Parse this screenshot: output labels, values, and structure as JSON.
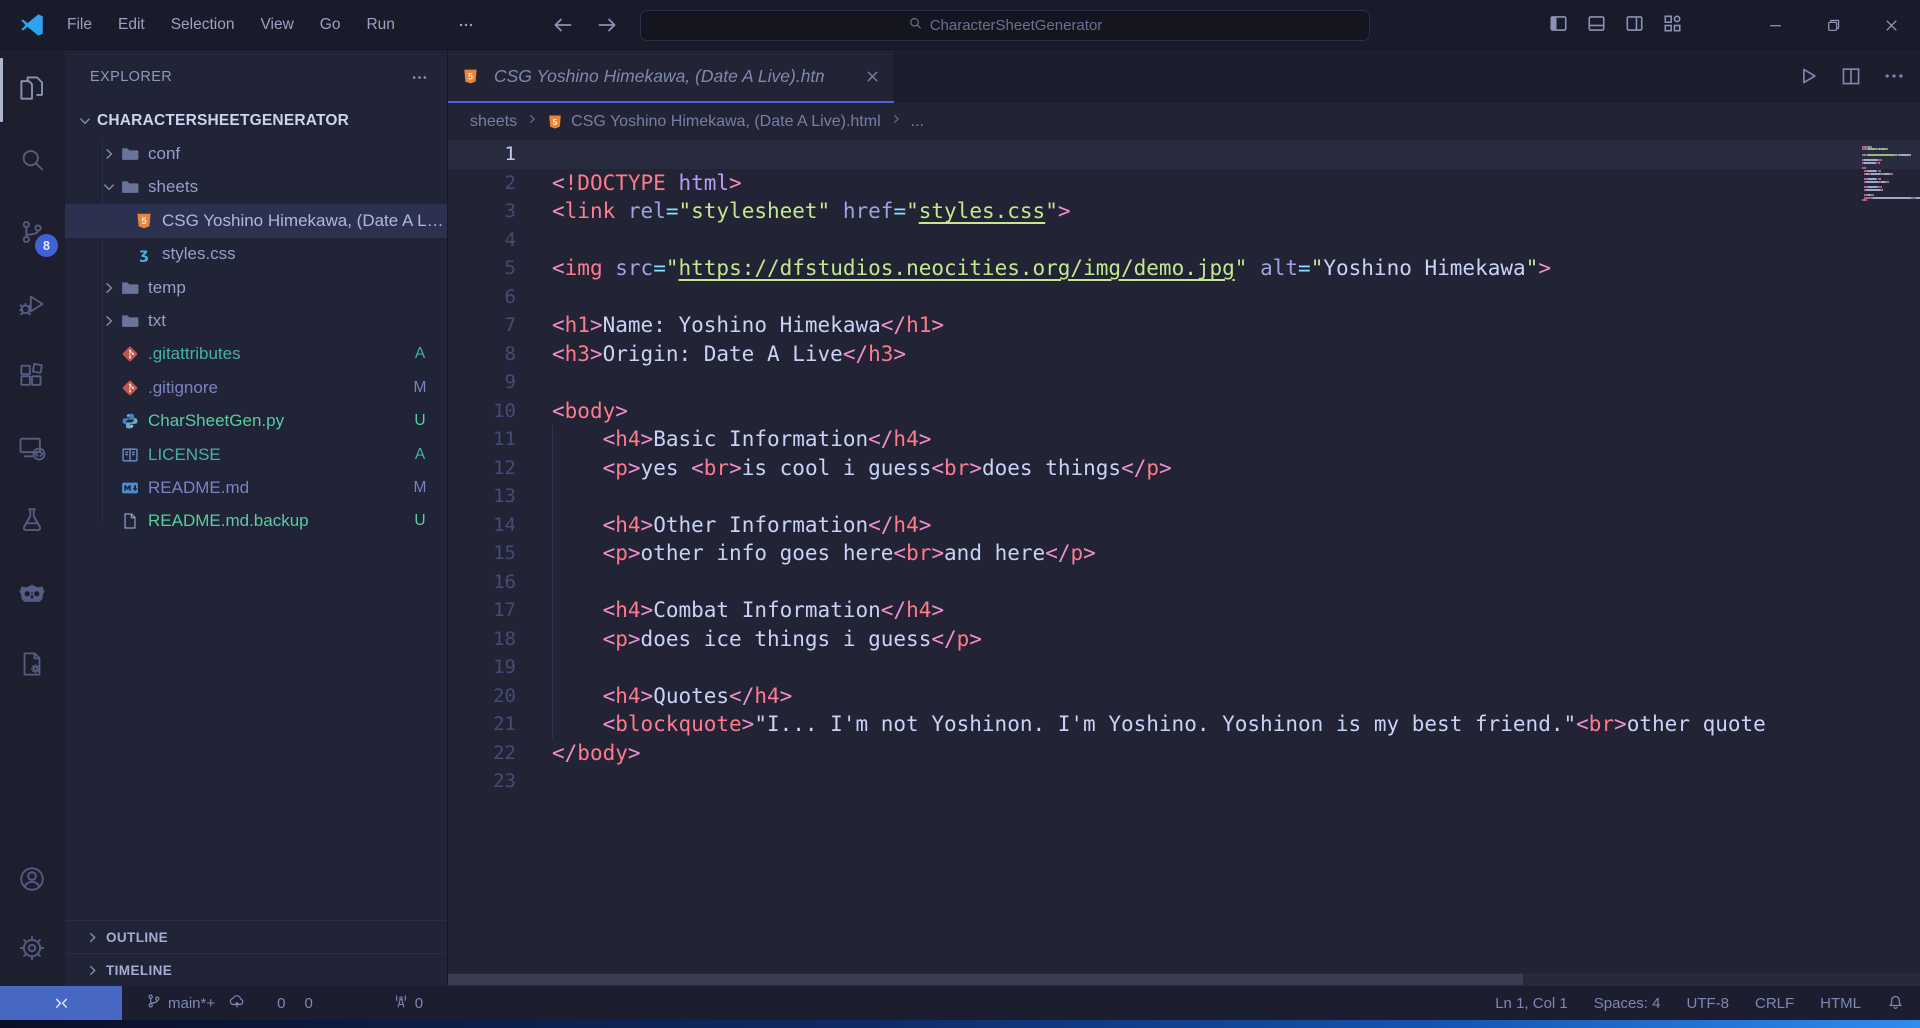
{
  "colors": {
    "accent_tab_border": "#4468e0",
    "remote_statusbar_blue": "#4668c2",
    "scm_badge_blue": "#3f63d6",
    "editor_bg": "#222436",
    "git": {
      "A": "#45b3a2",
      "M": "#7a83c5",
      "U": "#55cfa0"
    },
    "syntax": {
      "pb": "#f18fcb",
      "tag": "#ff7a8c",
      "kw": "#bb9cf5",
      "at": "#9ba4e2",
      "eq": "#86e1fc",
      "st": "#c3e88d",
      "lk": "#c3e88d",
      "tx": "#c8d3f5",
      "ws": "transparent"
    }
  },
  "title_bar": {
    "menus": [
      "File",
      "Edit",
      "Selection",
      "View",
      "Go",
      "Run"
    ],
    "search_text": "CharacterSheetGenerator"
  },
  "activity_bar": {
    "source_control_badge": "8"
  },
  "sidebar": {
    "header": "EXPLORER",
    "root": "CHARACTERSHEETGENERATOR",
    "items": [
      {
        "label": "conf",
        "icon": "folder",
        "chev": "r",
        "level": 1
      },
      {
        "label": "sheets",
        "icon": "folder",
        "chev": "d",
        "level": 1
      },
      {
        "label": "CSG Yoshino Himekawa, (Date A Live).html",
        "icon": "html",
        "level": 2,
        "sel": true
      },
      {
        "label": "styles.css",
        "icon": "css",
        "level": 2
      },
      {
        "label": "temp",
        "icon": "folder",
        "chev": "r",
        "level": 1
      },
      {
        "label": "txt",
        "icon": "folder",
        "chev": "r",
        "level": 1
      },
      {
        "label": ".gitattributes",
        "icon": "git",
        "level": 1,
        "status": "A"
      },
      {
        "label": ".gitignore",
        "icon": "git",
        "level": 1,
        "status": "M"
      },
      {
        "label": "CharSheetGen.py",
        "icon": "python",
        "level": 1,
        "status": "U"
      },
      {
        "label": "LICENSE",
        "icon": "license",
        "level": 1,
        "status": "A"
      },
      {
        "label": "README.md",
        "icon": "markdown",
        "level": 1,
        "status": "M"
      },
      {
        "label": "README.md.backup",
        "icon": "file",
        "level": 1,
        "status": "U"
      }
    ],
    "sections": [
      "OUTLINE",
      "TIMELINE"
    ]
  },
  "editor": {
    "tab": {
      "label": "CSG Yoshino Himekawa, (Date A Live).html",
      "icon": "html"
    },
    "breadcrumbs": {
      "folder": "sheets",
      "file": "CSG Yoshino Himekawa, (Date A Live).html",
      "more": "..."
    },
    "active_line": 1,
    "lines": [
      {
        "n": 1,
        "hl": 1,
        "t": []
      },
      {
        "n": 2,
        "t": [
          [
            "pb",
            "<"
          ],
          [
            "tag",
            "!DOCTYPE"
          ],
          [
            "tx",
            " "
          ],
          [
            "kw",
            "html"
          ],
          [
            "pb",
            ">"
          ]
        ]
      },
      {
        "n": 3,
        "t": [
          [
            "pb",
            "<"
          ],
          [
            "tag",
            "link"
          ],
          [
            "tx",
            " "
          ],
          [
            "at",
            "rel"
          ],
          [
            "eq",
            "="
          ],
          [
            "st",
            "\"stylesheet\""
          ],
          [
            "tx",
            " "
          ],
          [
            "at",
            "href"
          ],
          [
            "eq",
            "="
          ],
          [
            "st",
            "\""
          ],
          [
            "lk",
            "styles.css"
          ],
          [
            "st",
            "\""
          ],
          [
            "pb",
            ">"
          ]
        ]
      },
      {
        "n": 4,
        "t": []
      },
      {
        "n": 5,
        "t": [
          [
            "pb",
            "<"
          ],
          [
            "tag",
            "img"
          ],
          [
            "tx",
            " "
          ],
          [
            "at",
            "src"
          ],
          [
            "eq",
            "="
          ],
          [
            "st",
            "\""
          ],
          [
            "lk",
            "https://dfstudios.neocities.org/img/demo.jpg"
          ],
          [
            "st",
            "\""
          ],
          [
            "tx",
            " "
          ],
          [
            "at",
            "alt"
          ],
          [
            "eq",
            "="
          ],
          [
            "st",
            "\""
          ],
          [
            "tx",
            "Yoshino Himekawa"
          ],
          [
            "st",
            "\""
          ],
          [
            "pb",
            ">"
          ]
        ]
      },
      {
        "n": 6,
        "t": []
      },
      {
        "n": 7,
        "t": [
          [
            "pb",
            "<"
          ],
          [
            "tag",
            "h1"
          ],
          [
            "pb",
            ">"
          ],
          [
            "tx",
            "Name: Yoshino Himekawa"
          ],
          [
            "pb",
            "</"
          ],
          [
            "tag",
            "h1"
          ],
          [
            "pb",
            ">"
          ]
        ]
      },
      {
        "n": 8,
        "t": [
          [
            "pb",
            "<"
          ],
          [
            "tag",
            "h3"
          ],
          [
            "pb",
            ">"
          ],
          [
            "tx",
            "Origin: Date A Live"
          ],
          [
            "pb",
            "</"
          ],
          [
            "tag",
            "h3"
          ],
          [
            "pb",
            ">"
          ]
        ]
      },
      {
        "n": 9,
        "t": []
      },
      {
        "n": 10,
        "t": [
          [
            "pb",
            "<"
          ],
          [
            "tag",
            "body"
          ],
          [
            "pb",
            ">"
          ]
        ]
      },
      {
        "n": 11,
        "g": 1,
        "t": [
          [
            "ws",
            "    "
          ],
          [
            "pb",
            "<"
          ],
          [
            "tag",
            "h4"
          ],
          [
            "pb",
            ">"
          ],
          [
            "tx",
            "Basic Information"
          ],
          [
            "pb",
            "</"
          ],
          [
            "tag",
            "h4"
          ],
          [
            "pb",
            ">"
          ]
        ]
      },
      {
        "n": 12,
        "g": 1,
        "t": [
          [
            "ws",
            "    "
          ],
          [
            "pb",
            "<"
          ],
          [
            "tag",
            "p"
          ],
          [
            "pb",
            ">"
          ],
          [
            "tx",
            "yes "
          ],
          [
            "pb",
            "<"
          ],
          [
            "tag",
            "br"
          ],
          [
            "pb",
            ">"
          ],
          [
            "tx",
            "is cool i guess"
          ],
          [
            "pb",
            "<"
          ],
          [
            "tag",
            "br"
          ],
          [
            "pb",
            ">"
          ],
          [
            "tx",
            "does things"
          ],
          [
            "pb",
            "</"
          ],
          [
            "tag",
            "p"
          ],
          [
            "pb",
            ">"
          ]
        ]
      },
      {
        "n": 13,
        "g": 1,
        "t": []
      },
      {
        "n": 14,
        "g": 1,
        "t": [
          [
            "ws",
            "    "
          ],
          [
            "pb",
            "<"
          ],
          [
            "tag",
            "h4"
          ],
          [
            "pb",
            ">"
          ],
          [
            "tx",
            "Other Information"
          ],
          [
            "pb",
            "</"
          ],
          [
            "tag",
            "h4"
          ],
          [
            "pb",
            ">"
          ]
        ]
      },
      {
        "n": 15,
        "g": 1,
        "t": [
          [
            "ws",
            "    "
          ],
          [
            "pb",
            "<"
          ],
          [
            "tag",
            "p"
          ],
          [
            "pb",
            ">"
          ],
          [
            "tx",
            "other info goes here"
          ],
          [
            "pb",
            "<"
          ],
          [
            "tag",
            "br"
          ],
          [
            "pb",
            ">"
          ],
          [
            "tx",
            "and here"
          ],
          [
            "pb",
            "</"
          ],
          [
            "tag",
            "p"
          ],
          [
            "pb",
            ">"
          ]
        ]
      },
      {
        "n": 16,
        "g": 1,
        "t": []
      },
      {
        "n": 17,
        "g": 1,
        "t": [
          [
            "ws",
            "    "
          ],
          [
            "pb",
            "<"
          ],
          [
            "tag",
            "h4"
          ],
          [
            "pb",
            ">"
          ],
          [
            "tx",
            "Combat Information"
          ],
          [
            "pb",
            "</"
          ],
          [
            "tag",
            "h4"
          ],
          [
            "pb",
            ">"
          ]
        ]
      },
      {
        "n": 18,
        "g": 1,
        "t": [
          [
            "ws",
            "    "
          ],
          [
            "pb",
            "<"
          ],
          [
            "tag",
            "p"
          ],
          [
            "pb",
            ">"
          ],
          [
            "tx",
            "does ice things i guess"
          ],
          [
            "pb",
            "</"
          ],
          [
            "tag",
            "p"
          ],
          [
            "pb",
            ">"
          ]
        ]
      },
      {
        "n": 19,
        "g": 1,
        "t": []
      },
      {
        "n": 20,
        "g": 1,
        "t": [
          [
            "ws",
            "    "
          ],
          [
            "pb",
            "<"
          ],
          [
            "tag",
            "h4"
          ],
          [
            "pb",
            ">"
          ],
          [
            "tx",
            "Quotes"
          ],
          [
            "pb",
            "</"
          ],
          [
            "tag",
            "h4"
          ],
          [
            "pb",
            ">"
          ]
        ]
      },
      {
        "n": 21,
        "g": 1,
        "t": [
          [
            "ws",
            "    "
          ],
          [
            "pb",
            "<"
          ],
          [
            "tag",
            "blockquote"
          ],
          [
            "pb",
            ">"
          ],
          [
            "tx",
            "\"I... I'm not Yoshinon. I'm Yoshino. Yoshinon is my best friend.\""
          ],
          [
            "pb",
            "<"
          ],
          [
            "tag",
            "br"
          ],
          [
            "pb",
            ">"
          ],
          [
            "tx",
            "other quote"
          ]
        ]
      },
      {
        "n": 22,
        "t": [
          [
            "pb",
            "</"
          ],
          [
            "tag",
            "body"
          ],
          [
            "pb",
            ">"
          ]
        ]
      },
      {
        "n": 23,
        "t": []
      }
    ]
  },
  "status_bar": {
    "branch": "main*+",
    "errors": "0",
    "warnings": "0",
    "ports": "0",
    "right": [
      "Ln 1, Col 1",
      "Spaces: 4",
      "UTF-8",
      "CRLF",
      "HTML"
    ]
  }
}
